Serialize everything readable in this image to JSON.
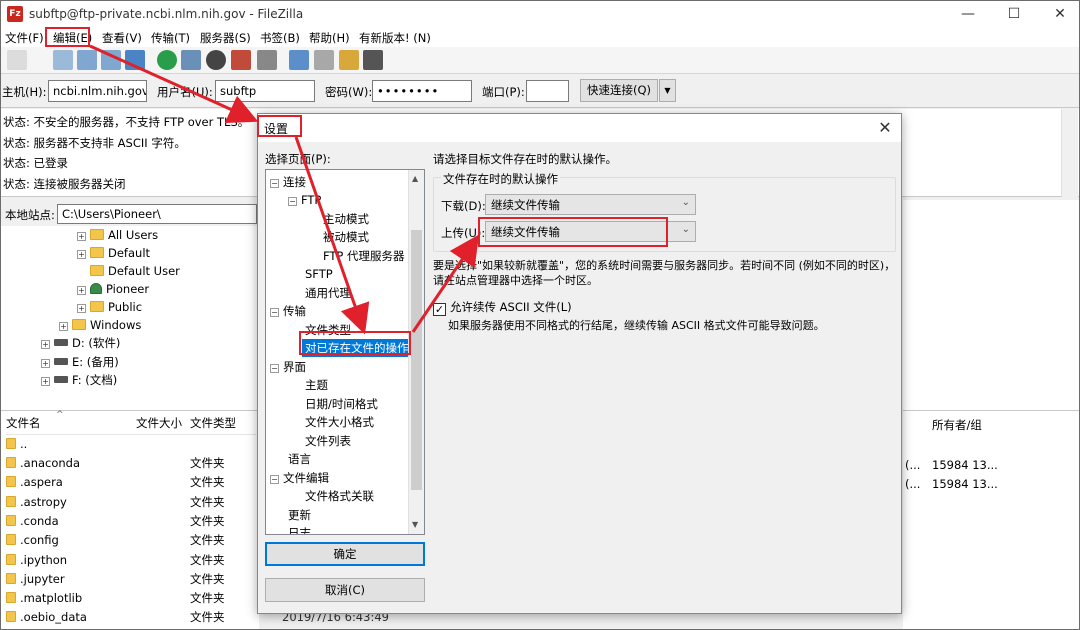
{
  "window": {
    "title": "subftp@ftp-private.ncbi.nlm.nih.gov - FileZilla",
    "icon_text": "Fz",
    "minimize": "—",
    "maximize": "☐",
    "close": "✕"
  },
  "menu": [
    "文件(F)",
    "编辑(E)",
    "查看(V)",
    "传输(T)",
    "服务器(S)",
    "书签(B)",
    "帮助(H)",
    "有新版本! (N)"
  ],
  "quickconnect": {
    "host_label": "主机(H):",
    "host_value": "ncbi.nlm.nih.gov",
    "user_label": "用户名(U):",
    "user_value": "subftp",
    "pass_label": "密码(W):",
    "pass_value": "••••••••",
    "port_label": "端口(P):",
    "port_value": "",
    "connect_label": "快速连接(Q)",
    "dropdown": "▼"
  },
  "log": [
    "状态:  不安全的服务器，不支持 FTP over TLS。",
    "状态:  服务器不支持非 ASCII 字符。",
    "状态:  已登录",
    "状态:  连接被服务器关闭"
  ],
  "local_site": {
    "label": "本地站点:",
    "path": "C:\\Users\\Pioneer\\"
  },
  "tree": [
    {
      "label": "All Users",
      "indent": 76,
      "exp": "+"
    },
    {
      "label": "Default",
      "indent": 76,
      "exp": "+"
    },
    {
      "label": "Default User",
      "indent": 76,
      "exp": ""
    },
    {
      "label": "Pioneer",
      "indent": 76,
      "exp": "+"
    },
    {
      "label": "Public",
      "indent": 76,
      "exp": "+"
    },
    {
      "label": "Windows",
      "indent": 58,
      "exp": "+"
    },
    {
      "label": "D: (软件)",
      "indent": 40,
      "exp": "+"
    },
    {
      "label": "E: (备用)",
      "indent": 40,
      "exp": "+"
    },
    {
      "label": "F: (文档)",
      "indent": 40,
      "exp": "+"
    }
  ],
  "filelist": {
    "headers": [
      "文件名",
      "文件大小",
      "文件类型"
    ],
    "rows": [
      {
        "name": "..",
        "type": ""
      },
      {
        "name": ".anaconda",
        "type": "文件夹"
      },
      {
        "name": ".aspera",
        "type": "文件夹"
      },
      {
        "name": ".astropy",
        "type": "文件夹"
      },
      {
        "name": ".conda",
        "type": "文件夹"
      },
      {
        "name": ".config",
        "type": "文件夹"
      },
      {
        "name": ".ipython",
        "type": "文件夹"
      },
      {
        "name": ".jupyter",
        "type": "文件夹"
      },
      {
        "name": ".matplotlib",
        "type": "文件夹"
      },
      {
        "name": ".oebio_data",
        "type": "文件夹"
      }
    ],
    "last_date": "2019/7/16 6:43:49"
  },
  "remote": {
    "header": "所有者/组",
    "rows": [
      {
        "perm": "(...",
        "owner": "15984 13..."
      },
      {
        "perm": "(...",
        "owner": "15984 13..."
      }
    ]
  },
  "dialog": {
    "title": "设置",
    "close": "✕",
    "select_page_label": "选择页面(P):",
    "pages": [
      {
        "label": "连接",
        "level": 0,
        "exp": "−"
      },
      {
        "label": "FTP",
        "level": 1,
        "exp": "−"
      },
      {
        "label": "主动模式",
        "level": 2,
        "exp": ""
      },
      {
        "label": "被动模式",
        "level": 2,
        "exp": ""
      },
      {
        "label": "FTP 代理服务器",
        "level": 2,
        "exp": ""
      },
      {
        "label": "SFTP",
        "level": 1,
        "exp": ""
      },
      {
        "label": "通用代理",
        "level": 1,
        "exp": ""
      },
      {
        "label": "传输",
        "level": 0,
        "exp": "−"
      },
      {
        "label": "文件类型",
        "level": 1,
        "exp": ""
      },
      {
        "label": "对已存在文件的操作",
        "level": 1,
        "exp": "",
        "selected": true
      },
      {
        "label": "界面",
        "level": 0,
        "exp": "−"
      },
      {
        "label": "主题",
        "level": 1,
        "exp": ""
      },
      {
        "label": "日期/时间格式",
        "level": 1,
        "exp": ""
      },
      {
        "label": "文件大小格式",
        "level": 1,
        "exp": ""
      },
      {
        "label": "文件列表",
        "level": 1,
        "exp": ""
      },
      {
        "label": "语言",
        "level": 0,
        "exp": ""
      },
      {
        "label": "文件编辑",
        "level": 0,
        "exp": "−"
      },
      {
        "label": "文件格式关联",
        "level": 1,
        "exp": ""
      },
      {
        "label": "更新",
        "level": 0,
        "exp": ""
      },
      {
        "label": "日志",
        "level": 0,
        "exp": ""
      }
    ],
    "ok_label": "确定",
    "cancel_label": "取消(C)",
    "instruction": "请选择目标文件存在时的默认操作。",
    "group_title": "文件存在时的默认操作",
    "download_label": "下载(D):",
    "download_value": "继续文件传输",
    "upload_label": "上传(U):",
    "upload_value": "继续文件传输",
    "note_line1": "要是选择\"如果较新就覆盖\"，您的系统时间需要与服务器同步。若时间不同 (例如不同的时区)，",
    "note_line2": "请在站点管理器中选择一个时区。",
    "ascii_label": "允许续传 ASCII 文件(L)",
    "ascii_checked": "✓",
    "ascii_desc": "如果服务器使用不同格式的行结尾，继续传输 ASCII 格式文件可能导致问题。"
  },
  "colors": {
    "annotation_red": "#e0202a",
    "selection_blue": "#0078d7"
  }
}
